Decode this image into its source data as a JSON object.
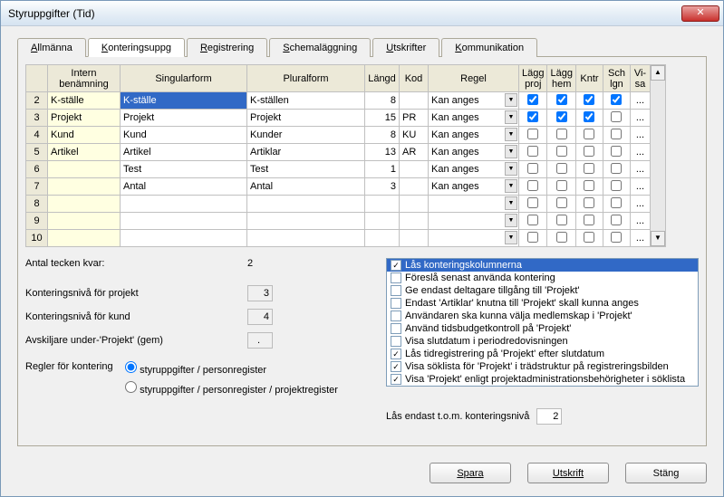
{
  "window": {
    "title": "Styruppgifter (Tid)"
  },
  "tabs": [
    {
      "label": "Allmänna",
      "accel": "A"
    },
    {
      "label": "Konteringsuppg",
      "accel": "K",
      "active": true
    },
    {
      "label": "Registrering",
      "accel": "R"
    },
    {
      "label": "Schemaläggning",
      "accel": "S"
    },
    {
      "label": "Utskrifter",
      "accel": "U"
    },
    {
      "label": "Kommunikation",
      "accel": "K"
    }
  ],
  "grid": {
    "headers": [
      "",
      "Intern benämning",
      "Singularform",
      "Pluralform",
      "Längd",
      "Kod",
      "Regel",
      "Lägg proj",
      "Lägg hem",
      "Kntr",
      "Sch lgn",
      "Vi- sa"
    ],
    "rows": [
      {
        "n": 2,
        "intern": "K-ställe",
        "sing": "K-ställe",
        "plur": "K-ställen",
        "len": 8,
        "kod": "",
        "regel": "Kan anges",
        "c": [
          true,
          true,
          true,
          true
        ],
        "selected": true
      },
      {
        "n": 3,
        "intern": "Projekt",
        "sing": "Projekt",
        "plur": "Projekt",
        "len": 15,
        "kod": "PR",
        "regel": "Kan anges",
        "c": [
          true,
          true,
          true,
          false
        ]
      },
      {
        "n": 4,
        "intern": "Kund",
        "sing": "Kund",
        "plur": "Kunder",
        "len": 8,
        "kod": "KU",
        "regel": "Kan anges",
        "c": [
          false,
          false,
          false,
          false
        ]
      },
      {
        "n": 5,
        "intern": "Artikel",
        "sing": "Artikel",
        "plur": "Artiklar",
        "len": 13,
        "kod": "AR",
        "regel": "Kan anges",
        "c": [
          false,
          false,
          false,
          false
        ]
      },
      {
        "n": 6,
        "intern": "",
        "sing": "Test",
        "plur": "Test",
        "len": 1,
        "kod": "",
        "regel": "Kan anges",
        "c": [
          false,
          false,
          false,
          false
        ]
      },
      {
        "n": 7,
        "intern": "",
        "sing": "Antal",
        "plur": "Antal",
        "len": 3,
        "kod": "",
        "regel": "Kan anges",
        "c": [
          false,
          false,
          false,
          false
        ]
      },
      {
        "n": 8,
        "intern": "",
        "sing": "",
        "plur": "",
        "len": "",
        "kod": "",
        "regel": "",
        "c": [
          false,
          false,
          false,
          false
        ]
      },
      {
        "n": 9,
        "intern": "",
        "sing": "",
        "plur": "",
        "len": "",
        "kod": "",
        "regel": "",
        "c": [
          false,
          false,
          false,
          false
        ]
      },
      {
        "n": 10,
        "intern": "",
        "sing": "",
        "plur": "",
        "len": "",
        "kod": "",
        "regel": "",
        "c": [
          false,
          false,
          false,
          false
        ]
      }
    ]
  },
  "counter": {
    "label": "Antal tecken kvar:",
    "value": "2"
  },
  "fields": {
    "projekt_label": "Konteringsnivå för projekt",
    "projekt_value": "3",
    "kund_label": "Konteringsnivå för kund",
    "kund_value": "4",
    "avskilj_label": "Avskiljare under-'Projekt' (gem)",
    "avskilj_value": "."
  },
  "radio": {
    "label": "Regler för kontering",
    "opt1": "styruppgifter / personregister",
    "opt2": "styruppgifter / personregister / projektregister",
    "selected": 1
  },
  "options": [
    {
      "checked": true,
      "label": "Lås konteringskolumnerna",
      "selected": true
    },
    {
      "checked": false,
      "label": "Föreslå senast använda kontering"
    },
    {
      "checked": false,
      "label": "Ge endast deltagare tillgång till 'Projekt'"
    },
    {
      "checked": false,
      "label": "Endast 'Artiklar' knutna till 'Projekt' skall kunna anges"
    },
    {
      "checked": false,
      "label": "Användaren ska kunna välja medlemskap i 'Projekt'"
    },
    {
      "checked": false,
      "label": "Använd tidsbudgetkontroll på 'Projekt'"
    },
    {
      "checked": false,
      "label": "Visa slutdatum i periodredovisningen"
    },
    {
      "checked": true,
      "label": "Lås tidregistrering på 'Projekt' efter slutdatum"
    },
    {
      "checked": true,
      "label": "Visa söklista för 'Projekt' i trädstruktur på registreringsbilden"
    },
    {
      "checked": true,
      "label": "Visa 'Projekt' enligt projektadministrationsbehörigheter i söklista"
    }
  ],
  "lock": {
    "label": "Lås endast t.o.m. konteringsnivå",
    "value": "2"
  },
  "buttons": {
    "save": "Spara",
    "print": "Utskrift",
    "close": "Stäng"
  }
}
